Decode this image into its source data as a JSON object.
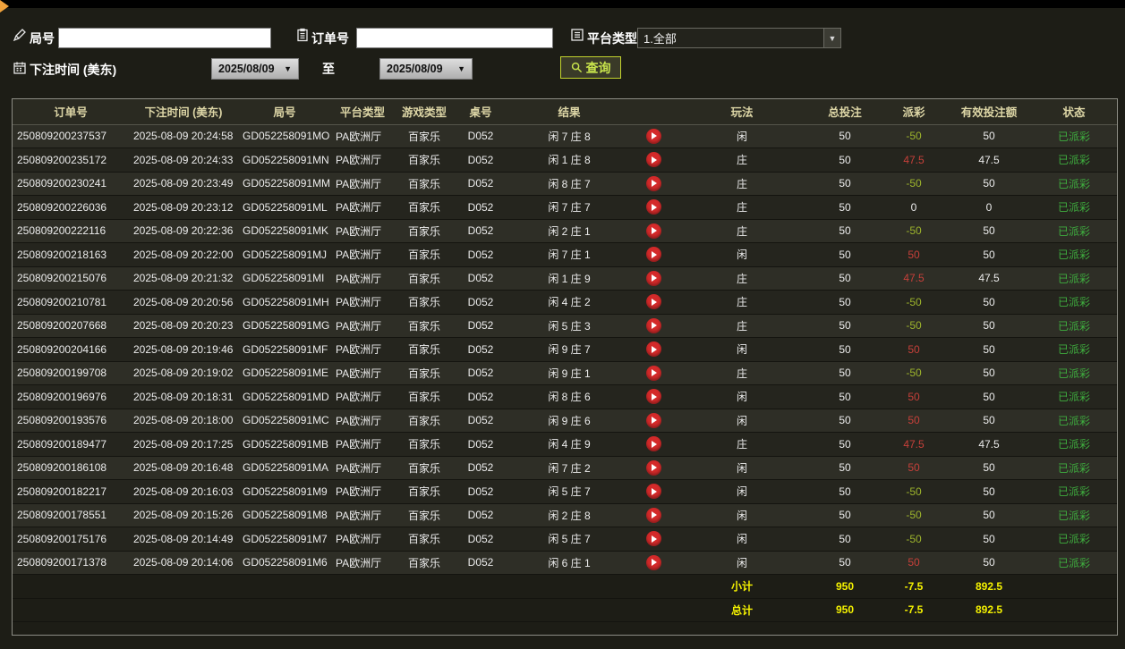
{
  "filters": {
    "round": {
      "label": "局号",
      "value": ""
    },
    "order": {
      "label": "订单号",
      "value": ""
    },
    "platform": {
      "label": "平台类型",
      "value": "1.全部"
    },
    "bet_time": {
      "label": "下注时间 (美东)"
    },
    "date_from": "2025/08/09",
    "to_label": "至",
    "date_to": "2025/08/09",
    "query_button": "查询"
  },
  "colors": {
    "win": "#c6403a",
    "loss": "#9cb32c",
    "status_paid": "#3fae3f",
    "summary": "#f5f200",
    "accent_border": "#c2d22e"
  },
  "table": {
    "headers": [
      "订单号",
      "下注时间 (美东)",
      "局号",
      "平台类型",
      "游戏类型",
      "桌号",
      "结果",
      "",
      "玩法",
      "总投注",
      "派彩",
      "有效投注额",
      "状态"
    ],
    "rows": [
      {
        "order_id": "250809200237537",
        "bet_time": "2025-08-09 20:24:58",
        "round_id": "GD052258091MO",
        "platform": "PA欧洲厅",
        "game": "百家乐",
        "table_no": "D052",
        "result": "闲 7 庄 8",
        "bet_on": "闲",
        "total_bet": "50",
        "payout": "-50",
        "payout_type": "loss",
        "valid_bet": "50",
        "status": "已派彩"
      },
      {
        "order_id": "250809200235172",
        "bet_time": "2025-08-09 20:24:33",
        "round_id": "GD052258091MN",
        "platform": "PA欧洲厅",
        "game": "百家乐",
        "table_no": "D052",
        "result": "闲 1 庄 8",
        "bet_on": "庄",
        "total_bet": "50",
        "payout": "47.5",
        "payout_type": "win",
        "valid_bet": "47.5",
        "status": "已派彩"
      },
      {
        "order_id": "250809200230241",
        "bet_time": "2025-08-09 20:23:49",
        "round_id": "GD052258091MM",
        "platform": "PA欧洲厅",
        "game": "百家乐",
        "table_no": "D052",
        "result": "闲 8 庄 7",
        "bet_on": "庄",
        "total_bet": "50",
        "payout": "-50",
        "payout_type": "loss",
        "valid_bet": "50",
        "status": "已派彩"
      },
      {
        "order_id": "250809200226036",
        "bet_time": "2025-08-09 20:23:12",
        "round_id": "GD052258091ML",
        "platform": "PA欧洲厅",
        "game": "百家乐",
        "table_no": "D052",
        "result": "闲 7 庄 7",
        "bet_on": "庄",
        "total_bet": "50",
        "payout": "0",
        "payout_type": "zero",
        "valid_bet": "0",
        "status": "已派彩"
      },
      {
        "order_id": "250809200222116",
        "bet_time": "2025-08-09 20:22:36",
        "round_id": "GD052258091MK",
        "platform": "PA欧洲厅",
        "game": "百家乐",
        "table_no": "D052",
        "result": "闲 2 庄 1",
        "bet_on": "庄",
        "total_bet": "50",
        "payout": "-50",
        "payout_type": "loss",
        "valid_bet": "50",
        "status": "已派彩"
      },
      {
        "order_id": "250809200218163",
        "bet_time": "2025-08-09 20:22:00",
        "round_id": "GD052258091MJ",
        "platform": "PA欧洲厅",
        "game": "百家乐",
        "table_no": "D052",
        "result": "闲 7 庄 1",
        "bet_on": "闲",
        "total_bet": "50",
        "payout": "50",
        "payout_type": "win",
        "valid_bet": "50",
        "status": "已派彩"
      },
      {
        "order_id": "250809200215076",
        "bet_time": "2025-08-09 20:21:32",
        "round_id": "GD052258091MI",
        "platform": "PA欧洲厅",
        "game": "百家乐",
        "table_no": "D052",
        "result": "闲 1 庄 9",
        "bet_on": "庄",
        "total_bet": "50",
        "payout": "47.5",
        "payout_type": "win",
        "valid_bet": "47.5",
        "status": "已派彩"
      },
      {
        "order_id": "250809200210781",
        "bet_time": "2025-08-09 20:20:56",
        "round_id": "GD052258091MH",
        "platform": "PA欧洲厅",
        "game": "百家乐",
        "table_no": "D052",
        "result": "闲 4 庄 2",
        "bet_on": "庄",
        "total_bet": "50",
        "payout": "-50",
        "payout_type": "loss",
        "valid_bet": "50",
        "status": "已派彩"
      },
      {
        "order_id": "250809200207668",
        "bet_time": "2025-08-09 20:20:23",
        "round_id": "GD052258091MG",
        "platform": "PA欧洲厅",
        "game": "百家乐",
        "table_no": "D052",
        "result": "闲 5 庄 3",
        "bet_on": "庄",
        "total_bet": "50",
        "payout": "-50",
        "payout_type": "loss",
        "valid_bet": "50",
        "status": "已派彩"
      },
      {
        "order_id": "250809200204166",
        "bet_time": "2025-08-09 20:19:46",
        "round_id": "GD052258091MF",
        "platform": "PA欧洲厅",
        "game": "百家乐",
        "table_no": "D052",
        "result": "闲 9 庄 7",
        "bet_on": "闲",
        "total_bet": "50",
        "payout": "50",
        "payout_type": "win",
        "valid_bet": "50",
        "status": "已派彩"
      },
      {
        "order_id": "250809200199708",
        "bet_time": "2025-08-09 20:19:02",
        "round_id": "GD052258091ME",
        "platform": "PA欧洲厅",
        "game": "百家乐",
        "table_no": "D052",
        "result": "闲 9 庄 1",
        "bet_on": "庄",
        "total_bet": "50",
        "payout": "-50",
        "payout_type": "loss",
        "valid_bet": "50",
        "status": "已派彩"
      },
      {
        "order_id": "250809200196976",
        "bet_time": "2025-08-09 20:18:31",
        "round_id": "GD052258091MD",
        "platform": "PA欧洲厅",
        "game": "百家乐",
        "table_no": "D052",
        "result": "闲 8 庄 6",
        "bet_on": "闲",
        "total_bet": "50",
        "payout": "50",
        "payout_type": "win",
        "valid_bet": "50",
        "status": "已派彩"
      },
      {
        "order_id": "250809200193576",
        "bet_time": "2025-08-09 20:18:00",
        "round_id": "GD052258091MC",
        "platform": "PA欧洲厅",
        "game": "百家乐",
        "table_no": "D052",
        "result": "闲 9 庄 6",
        "bet_on": "闲",
        "total_bet": "50",
        "payout": "50",
        "payout_type": "win",
        "valid_bet": "50",
        "status": "已派彩"
      },
      {
        "order_id": "250809200189477",
        "bet_time": "2025-08-09 20:17:25",
        "round_id": "GD052258091MB",
        "platform": "PA欧洲厅",
        "game": "百家乐",
        "table_no": "D052",
        "result": "闲 4 庄 9",
        "bet_on": "庄",
        "total_bet": "50",
        "payout": "47.5",
        "payout_type": "win",
        "valid_bet": "47.5",
        "status": "已派彩"
      },
      {
        "order_id": "250809200186108",
        "bet_time": "2025-08-09 20:16:48",
        "round_id": "GD052258091MA",
        "platform": "PA欧洲厅",
        "game": "百家乐",
        "table_no": "D052",
        "result": "闲 7 庄 2",
        "bet_on": "闲",
        "total_bet": "50",
        "payout": "50",
        "payout_type": "win",
        "valid_bet": "50",
        "status": "已派彩"
      },
      {
        "order_id": "250809200182217",
        "bet_time": "2025-08-09 20:16:03",
        "round_id": "GD052258091M9",
        "platform": "PA欧洲厅",
        "game": "百家乐",
        "table_no": "D052",
        "result": "闲 5 庄 7",
        "bet_on": "闲",
        "total_bet": "50",
        "payout": "-50",
        "payout_type": "loss",
        "valid_bet": "50",
        "status": "已派彩"
      },
      {
        "order_id": "250809200178551",
        "bet_time": "2025-08-09 20:15:26",
        "round_id": "GD052258091M8",
        "platform": "PA欧洲厅",
        "game": "百家乐",
        "table_no": "D052",
        "result": "闲 2 庄 8",
        "bet_on": "闲",
        "total_bet": "50",
        "payout": "-50",
        "payout_type": "loss",
        "valid_bet": "50",
        "status": "已派彩"
      },
      {
        "order_id": "250809200175176",
        "bet_time": "2025-08-09 20:14:49",
        "round_id": "GD052258091M7",
        "platform": "PA欧洲厅",
        "game": "百家乐",
        "table_no": "D052",
        "result": "闲 5 庄 7",
        "bet_on": "闲",
        "total_bet": "50",
        "payout": "-50",
        "payout_type": "loss",
        "valid_bet": "50",
        "status": "已派彩"
      },
      {
        "order_id": "250809200171378",
        "bet_time": "2025-08-09 20:14:06",
        "round_id": "GD052258091M6",
        "platform": "PA欧洲厅",
        "game": "百家乐",
        "table_no": "D052",
        "result": "闲 6 庄 1",
        "bet_on": "闲",
        "total_bet": "50",
        "payout": "50",
        "payout_type": "win",
        "valid_bet": "50",
        "status": "已派彩"
      }
    ],
    "summary": [
      {
        "label": "小计",
        "total_bet": "950",
        "payout": "-7.5",
        "valid_bet": "892.5"
      },
      {
        "label": "总计",
        "total_bet": "950",
        "payout": "-7.5",
        "valid_bet": "892.5"
      }
    ]
  }
}
